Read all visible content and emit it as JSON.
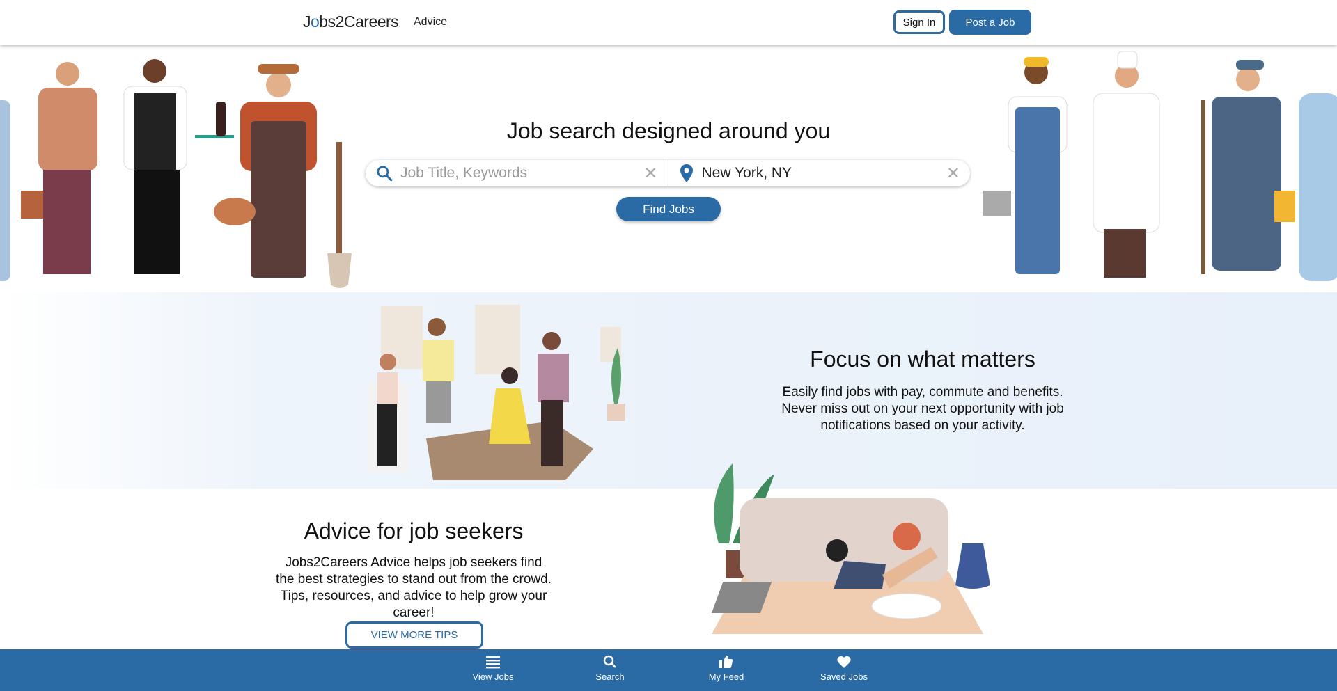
{
  "header": {
    "logo": "Jobs2Careers",
    "nav_advice": "Advice",
    "sign_in": "Sign In",
    "post_job": "Post a Job"
  },
  "hero": {
    "title": "Job search designed around you",
    "keyword_placeholder": "Job Title, Keywords",
    "keyword_value": "",
    "location_value": "New York, NY",
    "find_button": "Find Jobs"
  },
  "focus": {
    "title": "Focus on what matters",
    "text": "Easily find jobs with pay, commute and benefits. Never miss out on your next opportunity with job notifications based on your activity."
  },
  "advice": {
    "title": "Advice for job seekers",
    "text": "Jobs2Careers Advice helps job seekers find the best strategies to stand out from the crowd. Tips, resources, and advice to help grow your career!",
    "button": "VIEW MORE TIPS"
  },
  "bottom_nav": [
    {
      "label": "View Jobs",
      "icon": "list-icon"
    },
    {
      "label": "Search",
      "icon": "search-icon"
    },
    {
      "label": "My Feed",
      "icon": "thumbs-up-icon"
    },
    {
      "label": "Saved Jobs",
      "icon": "heart-icon"
    }
  ],
  "colors": {
    "brand": "#2a6aa5"
  }
}
